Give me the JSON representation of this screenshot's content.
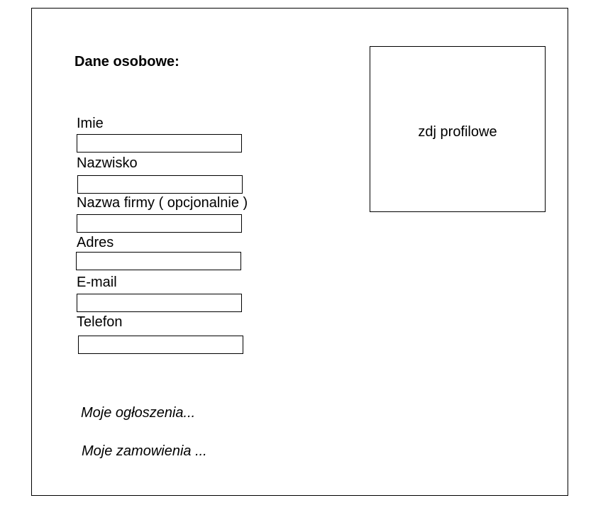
{
  "section": {
    "title": "Dane osobowe:"
  },
  "fields": [
    {
      "label": "Imie",
      "value": ""
    },
    {
      "label": "Nazwisko",
      "value": ""
    },
    {
      "label": "Nazwa firmy ( opcjonalnie )",
      "value": ""
    },
    {
      "label": "Adres",
      "value": ""
    },
    {
      "label": "E-mail",
      "value": ""
    },
    {
      "label": "Telefon",
      "value": ""
    }
  ],
  "profile_photo": {
    "label": "zdj profilowe"
  },
  "links": {
    "my_ads": "Moje ogłoszenia...",
    "my_orders": "Moje zamowienia ..."
  }
}
